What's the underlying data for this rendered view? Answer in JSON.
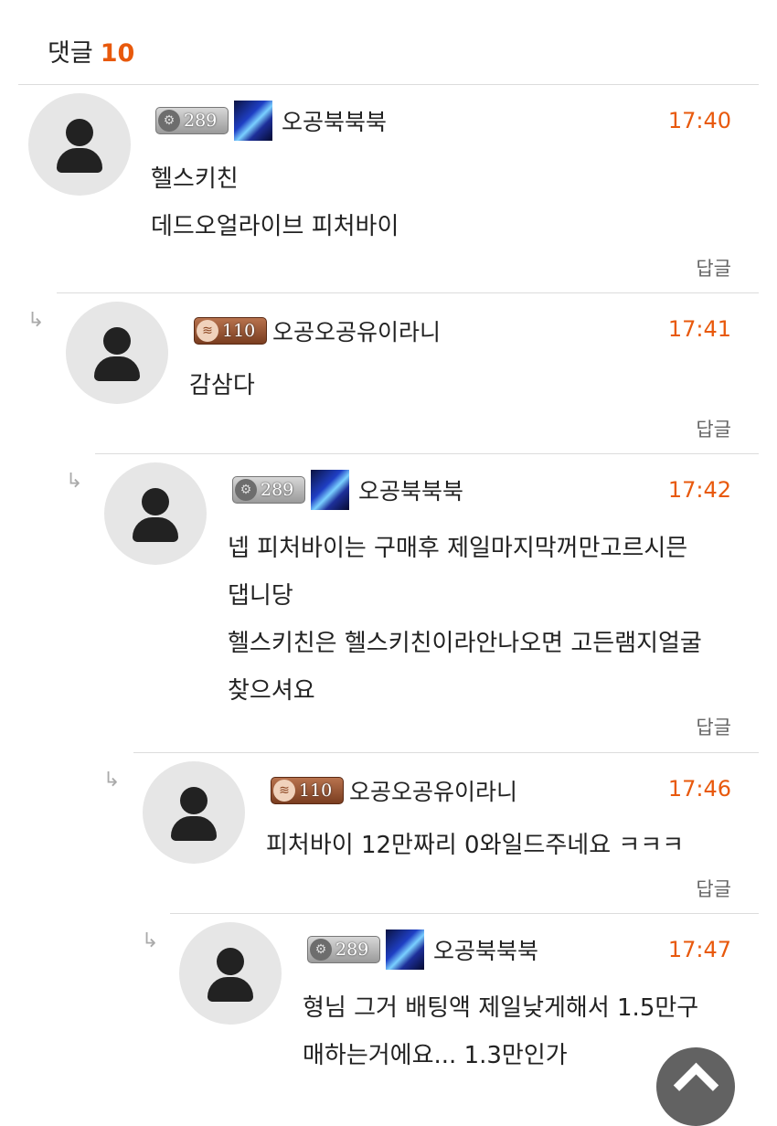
{
  "header": {
    "title": "댓글",
    "count": "10"
  },
  "comments": [
    {
      "level": "289",
      "badge": "gear",
      "user": "오공북북북",
      "time": "17:40",
      "lines": [
        "헬스키친",
        "데드오얼라이브 피처바이"
      ],
      "reply": "답글"
    },
    {
      "level": "110",
      "badge": "bronze",
      "user": "오공오공유이라니",
      "time": "17:41",
      "lines": [
        "감삼다"
      ],
      "reply": "답글"
    },
    {
      "level": "289",
      "badge": "gear",
      "user": "오공북북북",
      "time": "17:42",
      "lines": [
        "넵 피처바이는 구매후 제일마지막꺼만고르시믄",
        "댑니당",
        "헬스키친은 헬스키친이라안나오면 고든램지얼굴",
        "찾으셔요"
      ],
      "reply": "답글"
    },
    {
      "level": "110",
      "badge": "bronze",
      "user": "오공오공유이라니",
      "time": "17:46",
      "lines": [
        "피처바이 12만짜리 0와일드주네요 ㅋㅋㅋ"
      ],
      "reply": "답글"
    },
    {
      "level": "289",
      "badge": "gear",
      "user": "오공북북북",
      "time": "17:47",
      "lines": [
        "형님 그거 배팅액 제일낮게해서 1.5만구",
        "매하는거에요... 1.3만인가"
      ],
      "reply": "답글"
    }
  ],
  "icons": {
    "avatar": "user-silhouette-icon",
    "reply_arrow": "reply-indent-arrow-icon",
    "scroll_top": "chevron-up-icon"
  },
  "colors": {
    "accent": "#e8590c",
    "text": "#222222",
    "muted": "#666666"
  }
}
